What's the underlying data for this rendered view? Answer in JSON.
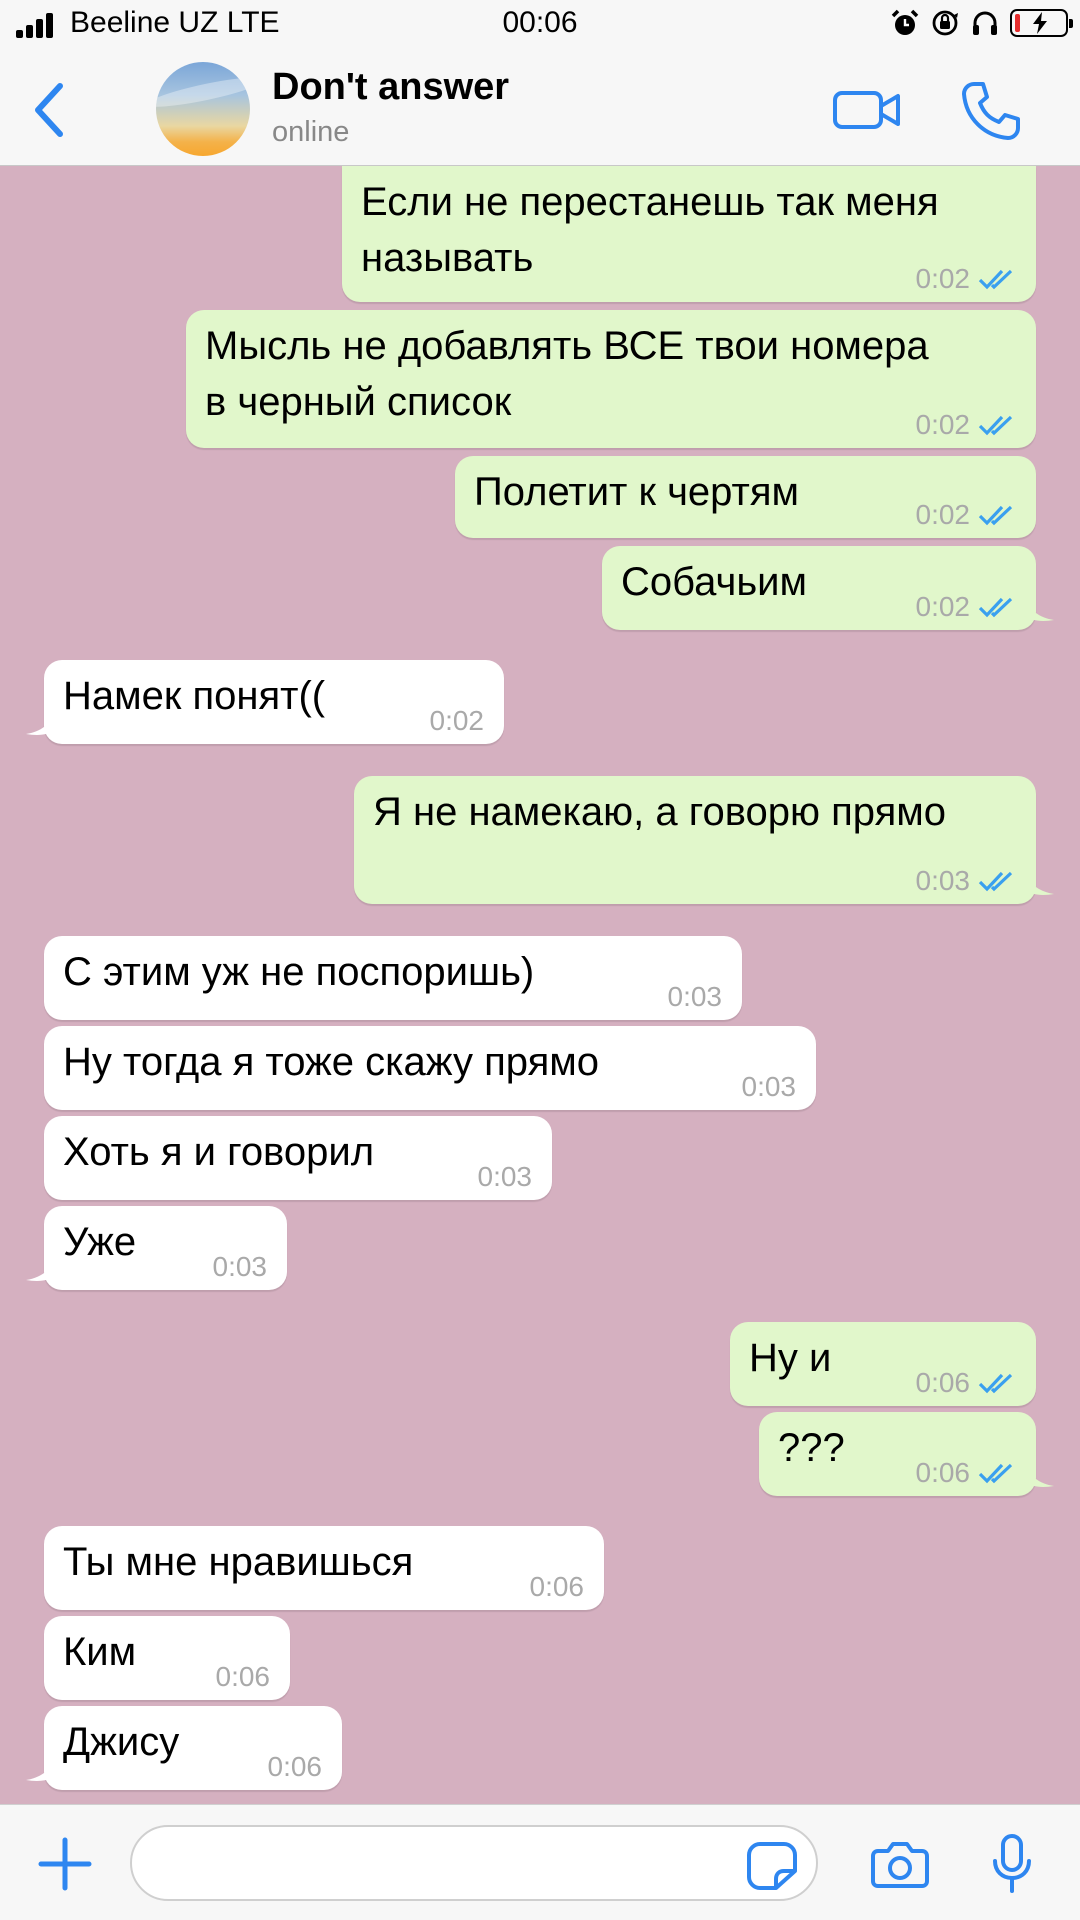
{
  "status_bar": {
    "carrier": "Beeline UZ LTE",
    "time": "00:06",
    "icons": [
      "signal-icon",
      "alarm-icon",
      "orientation-lock-icon",
      "headphones-icon",
      "battery-charging-icon"
    ]
  },
  "header": {
    "back_icon": "chevron-left-icon",
    "contact_name": "Don't answer",
    "contact_status": "online",
    "video_icon": "video-camera-icon",
    "call_icon": "phone-icon"
  },
  "colors": {
    "chat_background": "#d5b0c0",
    "outgoing_bubble": "#e1f7cb",
    "incoming_bubble": "#ffffff",
    "accent": "#2e86f0",
    "read_checkmarks": "#3aa0ef"
  },
  "messages": [
    {
      "dir": "out",
      "text": "Если не перестанешь так меня\nназывать",
      "time": "0:02",
      "read": true
    },
    {
      "dir": "out",
      "text": "Мысль не добавлять ВСЕ твои номера\nв черный список",
      "time": "0:02",
      "read": true
    },
    {
      "dir": "out",
      "text": "Полетит к чертям",
      "time": "0:02",
      "read": true
    },
    {
      "dir": "out",
      "text": "Собачьим",
      "time": "0:02",
      "read": true
    },
    {
      "dir": "in",
      "text": "Намек понят((",
      "time": "0:02"
    },
    {
      "dir": "out",
      "text": "Я не намекаю, а говорю прямо",
      "time": "0:03",
      "read": true
    },
    {
      "dir": "in",
      "text": "С этим уж не поспоришь)",
      "time": "0:03"
    },
    {
      "dir": "in",
      "text": "Ну тогда я тоже скажу прямо",
      "time": "0:03"
    },
    {
      "dir": "in",
      "text": "Хоть я и говорил",
      "time": "0:03"
    },
    {
      "dir": "in",
      "text": "Уже",
      "time": "0:03"
    },
    {
      "dir": "out",
      "text": "Ну и",
      "time": "0:06",
      "read": true
    },
    {
      "dir": "out",
      "text": "???",
      "time": "0:06",
      "read": true
    },
    {
      "dir": "in",
      "text": "Ты мне нравишься",
      "time": "0:06"
    },
    {
      "dir": "in",
      "text": "Ким",
      "time": "0:06"
    },
    {
      "dir": "in",
      "text": "Джису",
      "time": "0:06"
    }
  ],
  "input_bar": {
    "attach_icon": "plus-icon",
    "placeholder": "",
    "sticker_icon": "sticker-icon",
    "camera_icon": "camera-icon",
    "mic_icon": "microphone-icon"
  }
}
